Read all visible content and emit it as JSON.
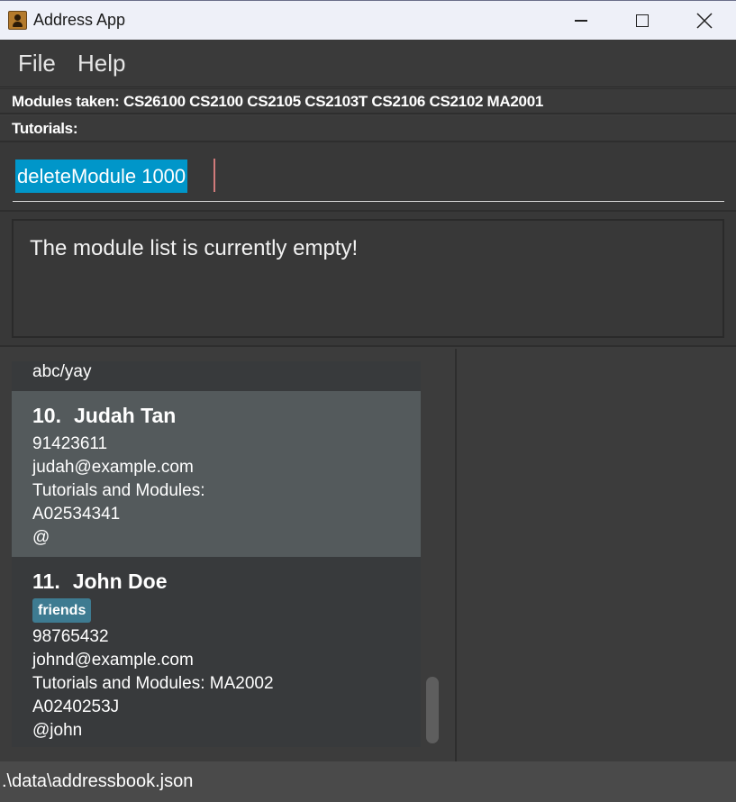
{
  "window": {
    "title": "Address App"
  },
  "menu": {
    "file": "File",
    "help": "Help"
  },
  "info": {
    "modules": "Modules taken: CS26100 CS2100 CS2105 CS2103T CS2106 CS2102 MA2001",
    "tutorials": "Tutorials:"
  },
  "command": {
    "value": "deleteModule 1000"
  },
  "result": {
    "text": "The module list is currently empty!"
  },
  "persons": [
    {
      "partial_line": "abc/yay"
    },
    {
      "index": "10.",
      "name": "Judah Tan",
      "phone": "91423611",
      "email": "judah@example.com",
      "tutorials_modules": "Tutorials and Modules:",
      "student_id": "A02534341",
      "handle": "@"
    },
    {
      "index": "11.",
      "name": "John Doe",
      "tag": "friends",
      "phone": "98765432",
      "email": "johnd@example.com",
      "tutorials_modules": "Tutorials and Modules: MA2002",
      "student_id": "A0240253J",
      "handle": "@john"
    }
  ],
  "status": {
    "path": ".\\data\\addressbook.json"
  },
  "colors": {
    "background": "#3c3c3c",
    "selected_card": "#545a5c",
    "tag": "#3e7b91",
    "command_highlight": "#0096c9",
    "titlebar": "#eef0f8"
  }
}
